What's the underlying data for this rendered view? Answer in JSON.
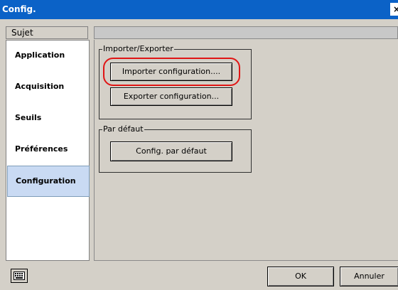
{
  "window": {
    "title": "Config.",
    "close_label": "×"
  },
  "sidebar": {
    "header": "Sujet",
    "items": [
      {
        "label": "Application"
      },
      {
        "label": "Acquisition"
      },
      {
        "label": "Seuils"
      },
      {
        "label": "Préférences"
      },
      {
        "label": "Configuration",
        "selected": true
      }
    ]
  },
  "main": {
    "import_export_group": {
      "legend": "Importer/Exporter",
      "import_button": "Importer configuration....",
      "export_button": "Exporter configuration..."
    },
    "default_group": {
      "legend": "Par défaut",
      "default_button": "Config. par défaut"
    }
  },
  "footer": {
    "keyboard_icon": "keyboard-icon",
    "ok_label": "OK",
    "cancel_label": "Annuler"
  },
  "colors": {
    "titlebar": "#0b62c7",
    "selected_item": "#c9daf3",
    "highlight": "#e01515"
  }
}
